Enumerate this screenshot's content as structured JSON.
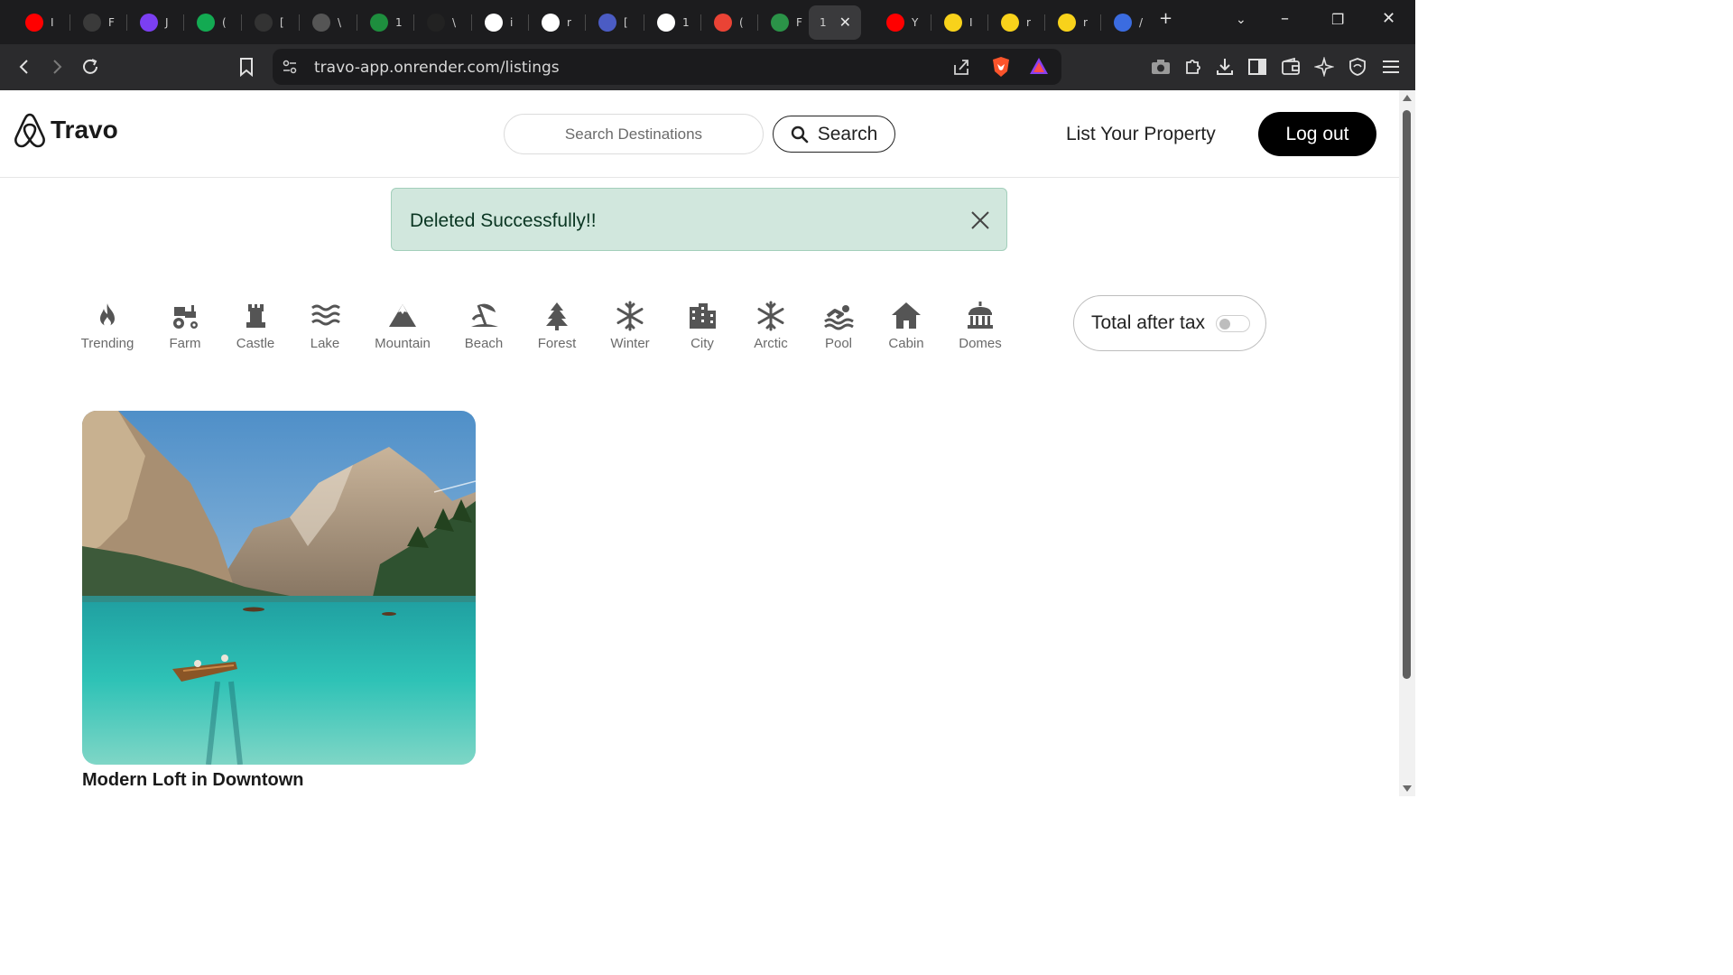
{
  "browser": {
    "tabs": [
      {
        "icon": "youtube-icon",
        "title": "I",
        "color": "#ff0000"
      },
      {
        "icon": "leaf-icon",
        "title": "F",
        "color": "#3a3a3a"
      },
      {
        "icon": "sparkle-icon",
        "title": "J",
        "color": "#7b3ff2"
      },
      {
        "icon": "mongodb-leaf-icon",
        "title": "(",
        "color": "#13aa52"
      },
      {
        "icon": "dark-globe-icon",
        "title": "[",
        "color": "#333333"
      },
      {
        "icon": "globe-icon",
        "title": "\\",
        "color": "#555555"
      },
      {
        "icon": "dx-icon",
        "title": "1",
        "color": "#1e8e3e"
      },
      {
        "icon": "is-icon",
        "title": "\\",
        "color": "#222222"
      },
      {
        "icon": "google-icon",
        "title": "i",
        "color": "#ffffff"
      },
      {
        "icon": "github-icon",
        "title": "r",
        "color": "#ffffff"
      },
      {
        "icon": "bird-icon",
        "title": "[",
        "color": "#4b5cc4"
      },
      {
        "icon": "openai-icon",
        "title": "1",
        "color": "#ffffff"
      },
      {
        "icon": "gmail-icon",
        "title": "(",
        "color": "#ea4335"
      },
      {
        "icon": "check-icon",
        "title": "F",
        "color": "#2b9348"
      },
      {
        "icon": "",
        "title": "1",
        "color": "",
        "active": true
      },
      {
        "icon": "youtube-icon",
        "title": "Y",
        "color": "#ff0000"
      },
      {
        "icon": "flipkart-icon",
        "title": "I",
        "color": "#f8d21b"
      },
      {
        "icon": "flipkart-icon",
        "title": "r",
        "color": "#f8d21b"
      },
      {
        "icon": "flipkart-icon",
        "title": "r",
        "color": "#f8d21b"
      },
      {
        "icon": "cloud-icon",
        "title": "/",
        "color": "#3b6ce0"
      }
    ],
    "url": "travo-app.onrender.com/listings"
  },
  "nav": {
    "brand": "Travo",
    "search_placeholder": "Search Destinations",
    "search_label": "Search",
    "list_property": "List Your Property",
    "logout": "Log out"
  },
  "alert": {
    "message": "Deleted Successfully!!",
    "bg_color": "#d1e7dd"
  },
  "filters": [
    {
      "label": "Trending",
      "icon": "fire-icon"
    },
    {
      "label": "Farm",
      "icon": "tractor-icon"
    },
    {
      "label": "Castle",
      "icon": "chess-rook-icon"
    },
    {
      "label": "Lake",
      "icon": "water-icon"
    },
    {
      "label": "Mountain",
      "icon": "mountain-icon"
    },
    {
      "label": "Beach",
      "icon": "umbrella-beach-icon"
    },
    {
      "label": "Forest",
      "icon": "tree-icon"
    },
    {
      "label": "Winter",
      "icon": "snowflake-icon"
    },
    {
      "label": "City",
      "icon": "city-icon"
    },
    {
      "label": "Arctic",
      "icon": "snowflake-icon"
    },
    {
      "label": "Pool",
      "icon": "person-swimming-icon"
    },
    {
      "label": "Cabin",
      "icon": "house-icon"
    },
    {
      "label": "Domes",
      "icon": "landmark-dome-icon"
    }
  ],
  "tax_toggle": {
    "label": "Total after tax",
    "on": false
  },
  "listings": [
    {
      "title": "Modern Loft in Downtown",
      "image": "mountain-lake-photo"
    }
  ]
}
